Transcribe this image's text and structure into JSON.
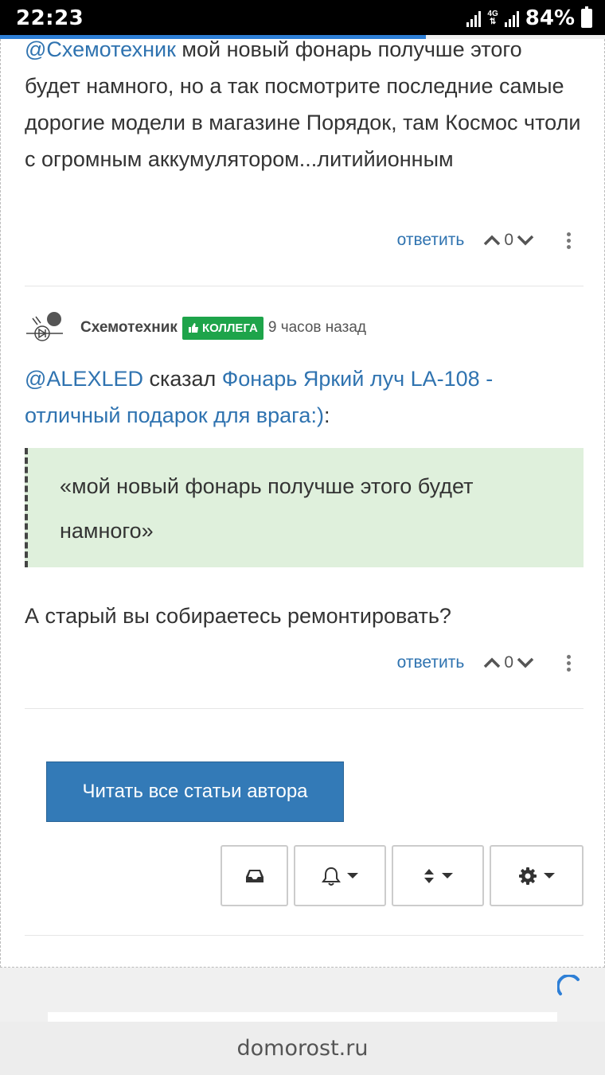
{
  "status_bar": {
    "time": "22:23",
    "network": "4G",
    "battery": "84%"
  },
  "comment1": {
    "mention": "@Схемотехник",
    "text": " мой новый фонарь получше этого будет намного, но а так посмотрите последние самые дорогие модели в магазине Порядок, там Космос чтоли с огромным аккумулятором...литийионным",
    "reply_label": "ответить",
    "votes": "0"
  },
  "comment2": {
    "author": "Схемотехник",
    "badge": "КОЛЛЕГА",
    "time_ago": "9 часов назад",
    "mention": "@ALEXLED",
    "said": " сказал ",
    "linked_title": "Фонарь Яркий луч LA-108 - отличный подарок для врага:)",
    "colon": ":",
    "quote": "«мой новый фонарь получше этого будет намного»",
    "text": "А старый вы собираетесь ремонтировать?",
    "reply_label": "ответить",
    "votes": "0"
  },
  "read_all_button": "Читать все статьи автора",
  "toolbar_icons": [
    "inbox-icon",
    "bell-icon",
    "sort-icon",
    "gear-icon"
  ],
  "footer": {
    "domain": "domorost.ru"
  },
  "colors": {
    "link": "#2f73b0",
    "badge": "#1ea44a",
    "quote_bg": "#dff0dc",
    "primary_button": "#337ab7"
  }
}
